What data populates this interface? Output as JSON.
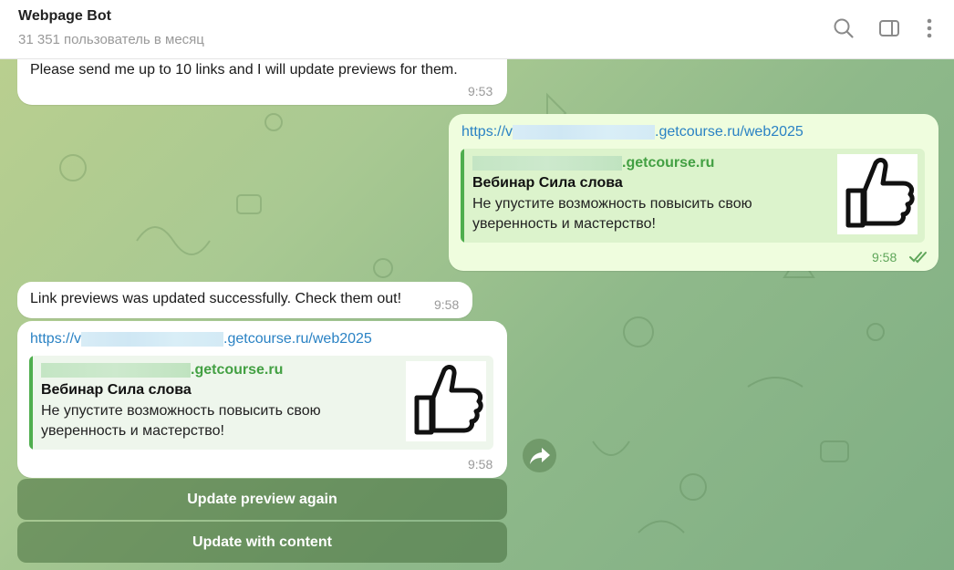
{
  "header": {
    "title": "Webpage Bot",
    "subtitle": "31 351 пользователь в месяц",
    "icons": [
      "search-icon",
      "sidebar-toggle-icon",
      "more-vertical-icon"
    ]
  },
  "messages": {
    "bot_intro": {
      "text": "Please send me up to 10 links and I will update previews for them.",
      "time": "9:53"
    },
    "user_link": {
      "link_prefix": "https://v",
      "link_suffix": ".getcourse.ru/web2025",
      "preview_site_suffix": ".getcourse.ru",
      "preview_title": "Вебинар Сила слова",
      "preview_desc_line1": "Не упустите возможность повысить свою",
      "preview_desc_line2": "уверенность и мастерство!",
      "time": "9:58",
      "status_icon": "double-check-icon"
    },
    "bot_success": {
      "text": "Link previews was updated successfully. Check them out!",
      "time": "9:58"
    },
    "bot_link": {
      "link_prefix": "https://v",
      "link_suffix": ".getcourse.ru/web2025",
      "preview_site_suffix": ".getcourse.ru",
      "preview_title": "Вебинар Сила слова",
      "preview_desc_line1": "Не упустите возможность повысить свою",
      "preview_desc_line2": "уверенность и мастерство!",
      "time": "9:58"
    }
  },
  "keyboard": {
    "update_again": "Update preview again",
    "update_content": "Update with content"
  },
  "colors": {
    "link": "#2a82c4",
    "preview_accent": "#4fae4e",
    "outgoing_bubble": "#effdde"
  }
}
